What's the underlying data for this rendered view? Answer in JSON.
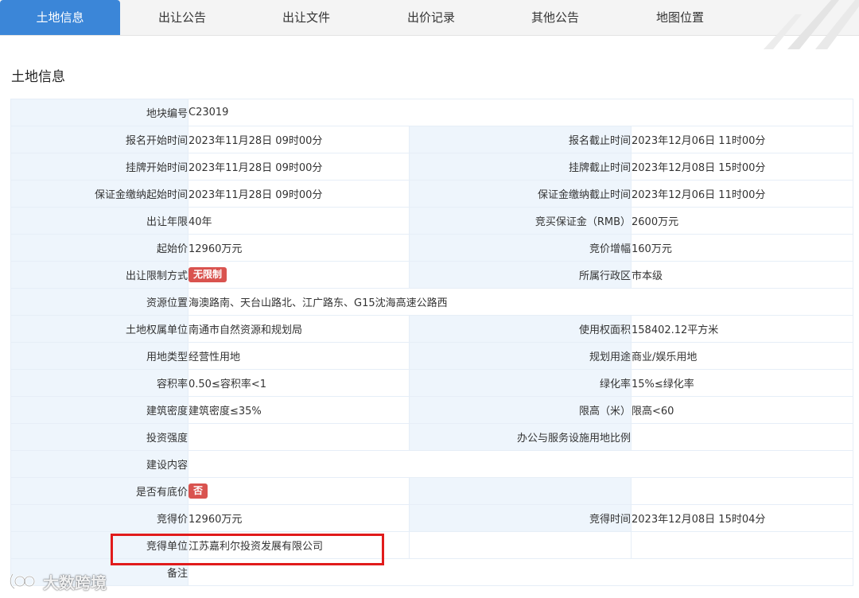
{
  "tabs": [
    {
      "label": "土地信息"
    },
    {
      "label": "出让公告"
    },
    {
      "label": "出让文件"
    },
    {
      "label": "出价记录"
    },
    {
      "label": "其他公告"
    },
    {
      "label": "地图位置"
    }
  ],
  "section_title": "土地信息",
  "fields": {
    "parcel_no": {
      "label": "地块编号",
      "value": "C23019"
    },
    "reg_start": {
      "label": "报名开始时间",
      "value": "2023年11月28日 09时00分"
    },
    "reg_end": {
      "label": "报名截止时间",
      "value": "2023年12月06日 11时00分"
    },
    "list_start": {
      "label": "挂牌开始时间",
      "value": "2023年11月28日 09时00分"
    },
    "list_end": {
      "label": "挂牌截止时间",
      "value": "2023年12月08日 15时00分"
    },
    "deposit_start": {
      "label": "保证金缴纳起始时间",
      "value": "2023年11月28日 09时00分"
    },
    "deposit_end": {
      "label": "保证金缴纳截止时间",
      "value": "2023年12月06日 11时00分"
    },
    "term": {
      "label": "出让年限",
      "value": "40年"
    },
    "deposit": {
      "label": "竞买保证金（RMB）",
      "value": "2600万元"
    },
    "start_price": {
      "label": "起始价",
      "value": "12960万元"
    },
    "increment": {
      "label": "竞价增幅",
      "value": "160万元"
    },
    "restriction": {
      "label": "出让限制方式",
      "value": "无限制"
    },
    "district": {
      "label": "所属行政区",
      "value": "市本级"
    },
    "location": {
      "label": "资源位置",
      "value": "海澳路南、天台山路北、江广路东、G15沈海高速公路西"
    },
    "owner": {
      "label": "土地权属单位",
      "value": "南通市自然资源和规划局"
    },
    "area": {
      "label": "使用权面积",
      "value": "158402.12平方米"
    },
    "land_type": {
      "label": "用地类型",
      "value": "经营性用地"
    },
    "planned_use": {
      "label": "规划用途",
      "value": "商业/娱乐用地"
    },
    "far": {
      "label": "容积率",
      "value": "0.50≤容积率<1"
    },
    "green": {
      "label": "绿化率",
      "value": "15%≤绿化率"
    },
    "density": {
      "label": "建筑密度",
      "value": "建筑密度≤35%"
    },
    "height": {
      "label": "限高（米）",
      "value": "限高<60"
    },
    "invest": {
      "label": "投资强度",
      "value": ""
    },
    "office_ratio": {
      "label": "办公与服务设施用地比例",
      "value": ""
    },
    "content": {
      "label": "建设内容",
      "value": ""
    },
    "reserve": {
      "label": "是否有底价",
      "value": "否"
    },
    "win_price": {
      "label": "竞得价",
      "value": "12960万元"
    },
    "win_time": {
      "label": "竞得时间",
      "value": "2023年12月08日 15时04分"
    },
    "winner": {
      "label": "竞得单位",
      "value": "江苏嘉利尔投资发展有限公司"
    },
    "remark": {
      "label": "备注",
      "value": ""
    }
  },
  "watermark": {
    "text": "大数跨境"
  },
  "colors": {
    "tab_active_bg": "#3b86d8",
    "label_bg": "#eef5fc",
    "badge_red": "#d9534f",
    "highlight_red": "#e11b1b"
  }
}
